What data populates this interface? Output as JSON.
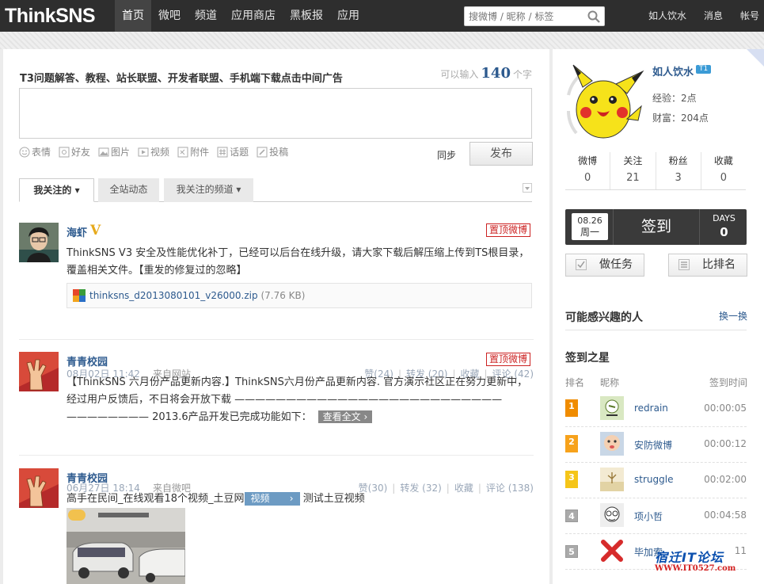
{
  "header": {
    "logo": "ThinkSNS",
    "nav": [
      "首页",
      "微吧",
      "频道",
      "应用商店",
      "黑板报",
      "应用"
    ],
    "search_placeholder": "搜微博 / 昵称 / 标签",
    "user": "如人饮水",
    "messages": "消息",
    "account": "帐号"
  },
  "composer": {
    "title": "T3问题解答、教程、站长联盟、开发者联盟、手机端下载点击中间广告",
    "counter_prefix": "可以输入",
    "counter_value": "140",
    "counter_suffix": "个字",
    "tools": [
      "表情",
      "好友",
      "图片",
      "视频",
      "附件",
      "话题",
      "投稿"
    ],
    "sync": "同步",
    "publish": "发布"
  },
  "tabs": [
    "我关注的",
    "全站动态",
    "我关注的频道"
  ],
  "feed": [
    {
      "user": "海虾",
      "badge": "V",
      "pin": "置顶微博",
      "content": "ThinkSNS V3 安全及性能优化补丁，已经可以后台在线升级，请大家下载后解压缩上传到TS根目录，覆盖相关文件。【重发的修复过的忽略】",
      "attachment_name": "thinksns_d2013080101_v26000.zip",
      "attachment_size": "(7.76 KB)",
      "time": "08月02日 11:42",
      "source": "来自网站",
      "like": "赞(24)",
      "repost": "转发 (20)",
      "fav": "收藏",
      "comment": "评论 (42)"
    },
    {
      "user": "青青校园",
      "pin": "置顶微博",
      "content_line1": "【ThinkSNS 六月份产品更新内容.】ThinkSNS六月份产品更新内容. 官方演示社区正在努力更新中，经过用户反馈后，不日将会开放下载 ——————————————————————————",
      "content_line2": "———————— 2013.6产品开发已完成功能如下：",
      "read_more": "查看全文",
      "time": "06月27日 18:14",
      "source": "来自微吧",
      "like": "赞(30)",
      "repost": "转发 (32)",
      "fav": "收藏",
      "comment": "评论 (138)"
    },
    {
      "user": "青青校园",
      "content_before": "高手在民间_在线观看18个视频_土豆网",
      "video_tag": "视频",
      "content_after": "测试土豆视频"
    }
  ],
  "profile": {
    "name": "如人饮水",
    "level": "T1",
    "exp": "经验：2点",
    "wealth": "财富：204点",
    "stats": [
      {
        "label": "微博",
        "value": "0"
      },
      {
        "label": "关注",
        "value": "21"
      },
      {
        "label": "粉丝",
        "value": "3"
      },
      {
        "label": "收藏",
        "value": "0"
      }
    ]
  },
  "checkin": {
    "date": "08.26",
    "weekday": "周一",
    "button": "签到",
    "days_label": "DAYS",
    "days_value": "0"
  },
  "side_buttons": {
    "task": "做任务",
    "rank": "比排名"
  },
  "interest": {
    "title": "可能感兴趣的人",
    "refresh": "换一换"
  },
  "stars": {
    "title": "签到之星",
    "col_rank": "排名",
    "col_name": "昵称",
    "col_time": "签到时间",
    "rows": [
      {
        "rank": "1",
        "name": "redrain",
        "time": "00:00:05"
      },
      {
        "rank": "2",
        "name": "安防微博",
        "time": "00:00:12"
      },
      {
        "rank": "3",
        "name": "struggle",
        "time": "00:02:00"
      },
      {
        "rank": "4",
        "name": "项小哲",
        "time": "00:04:58"
      },
      {
        "rank": "5",
        "name": "毕加索",
        "time": "11"
      }
    ]
  },
  "watermark": {
    "line1": "宿迁IT论坛",
    "line2": "WWW.IT0527.com"
  }
}
